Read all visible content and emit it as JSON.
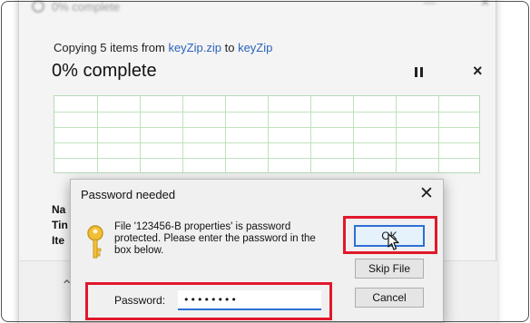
{
  "progress_window": {
    "title": "0% complete",
    "copy_prefix": "Copying 5 items from",
    "source": "keyZip.zip",
    "to_word": "to",
    "destination": "keyZip",
    "percent_complete": "0% complete",
    "progress": 0,
    "side_labels": [
      "Na",
      "Tin",
      "Ite"
    ]
  },
  "dialog": {
    "title": "Password needed",
    "message": "File '123456-B properties' is password protected. Please enter the password in the box below.",
    "ok_label": "OK",
    "skip_label": "Skip File",
    "cancel_label": "Cancel",
    "password_label": "Password:",
    "password_value": "secret12"
  },
  "colors": {
    "highlight": "#e1182a",
    "accent": "#2d6fd6",
    "link": "#2a64b8",
    "graph_grid": "#bfe2bf"
  },
  "icons": {
    "dialog": "key-icon",
    "pause": "pause-icon",
    "close": "close-icon",
    "cursor": "mouse-pointer-icon"
  }
}
